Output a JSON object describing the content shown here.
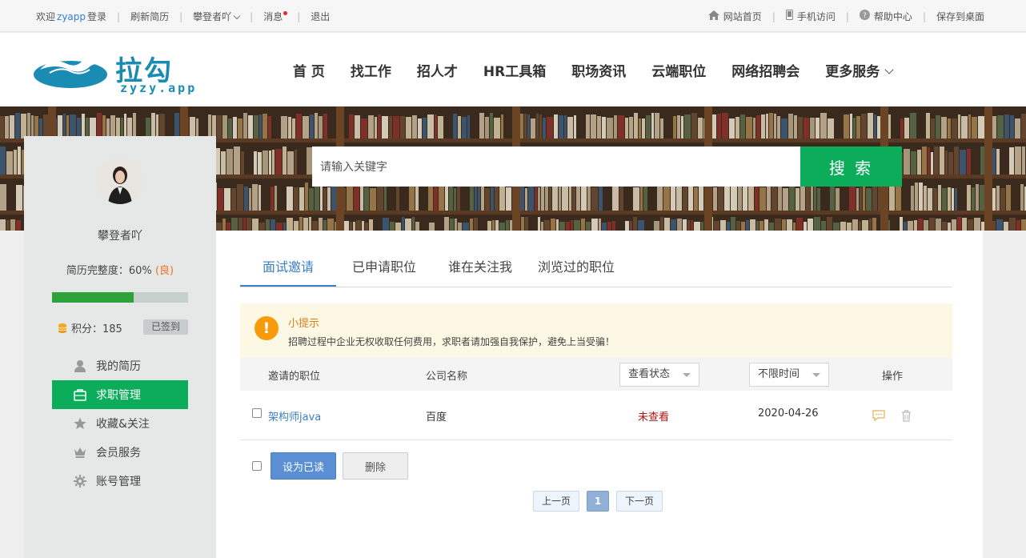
{
  "topbar": {
    "welcome": "欢迎",
    "user": "zyapp",
    "login": "登录",
    "refresh_resume": "刷新简历",
    "nickname": "攀登者吖",
    "messages": "消息",
    "logout": "退出",
    "home": "网站首页",
    "mobile": "手机访问",
    "help": "帮助中心",
    "save_desktop": "保存到桌面"
  },
  "logo": {
    "name": "拉勾",
    "domain": "zyzy.app"
  },
  "nav": [
    "首 页",
    "找工作",
    "招人才",
    "HR工具箱",
    "职场资讯",
    "云端职位",
    "网络招聘会",
    "更多服务"
  ],
  "search": {
    "placeholder": "请输入关键字",
    "button": "搜 索"
  },
  "sidebar": {
    "username": "攀登者吖",
    "completeness_label": "简历完整度：60%",
    "completeness_grade": "(良)",
    "completeness_value": 0.6,
    "points": "积分：185",
    "signed": "已签到",
    "menu": [
      {
        "label": "我的简历",
        "icon": "user-icon"
      },
      {
        "label": "求职管理",
        "icon": "briefcase-icon",
        "active": true
      },
      {
        "label": "收藏&关注",
        "icon": "star-icon"
      },
      {
        "label": "会员服务",
        "icon": "crown-icon"
      },
      {
        "label": "账号管理",
        "icon": "gear-icon"
      }
    ]
  },
  "tabs": [
    "面试邀请",
    "已申请职位",
    "谁在关注我",
    "浏览过的职位"
  ],
  "tip": {
    "title": "小提示",
    "text": "招聘过程中企业无权收取任何费用，求职者请加强自我保护，避免上当受骗！"
  },
  "table": {
    "col_position": "邀请的职位",
    "col_company": "公司名称",
    "filter_status": "查看状态",
    "filter_time": "不限时间",
    "col_actions": "操作",
    "rows": [
      {
        "position": "架构师java",
        "company": "百度",
        "status": "未查看",
        "date": "2020-04-26"
      }
    ]
  },
  "actions": {
    "mark_read": "设为已读",
    "delete": "删除"
  },
  "pager": {
    "prev": "上一页",
    "current": "1",
    "next": "下一页"
  },
  "colors": {
    "green": "#0bac5a",
    "blue": "#3d7fc1",
    "orange": "#f79a0c",
    "unread": "#b31313"
  }
}
